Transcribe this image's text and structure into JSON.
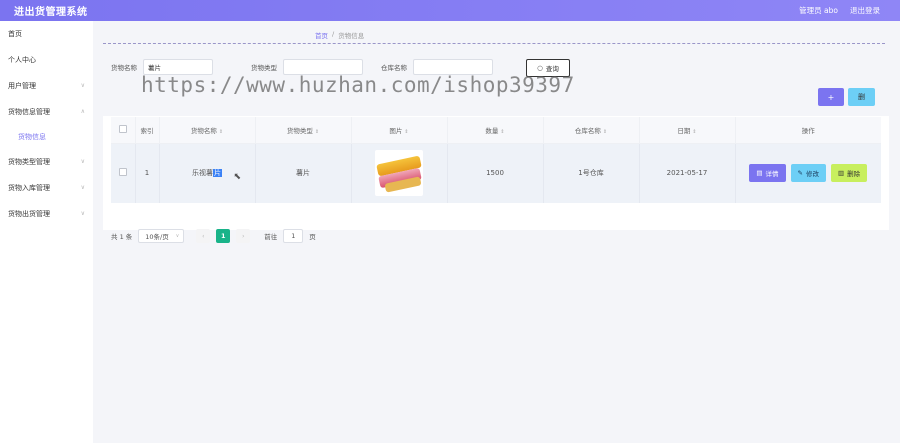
{
  "header": {
    "title": "进出货管理系统",
    "user_label": "管理员 abo",
    "logout_label": "退出登录"
  },
  "sidebar": {
    "items": [
      {
        "label": "首页"
      },
      {
        "label": "个人中心"
      },
      {
        "label": "用户管理"
      },
      {
        "label": "货物信息管理"
      },
      {
        "label": "货物信息"
      },
      {
        "label": "货物类型管理"
      },
      {
        "label": "货物入库管理"
      },
      {
        "label": "货物出货管理"
      }
    ]
  },
  "breadcrumb": {
    "home": "首页",
    "separator": "/",
    "current": "货物信息"
  },
  "search": {
    "field1_label": "货物名称",
    "field1_value": "薯片",
    "field2_label": "货物类型",
    "field3_label": "仓库名称",
    "query_label": "查询"
  },
  "watermark": "https://www.huzhan.com/ishop39397",
  "actions": {
    "add_label": "+",
    "delete_label": "删"
  },
  "table": {
    "headers": [
      "索引",
      "货物名称",
      "货物类型",
      "图片",
      "数量",
      "仓库名称",
      "日期",
      "操作"
    ],
    "rows": [
      {
        "index": "1",
        "name_pre": "乐视薯",
        "name_hl": "片",
        "type": "薯片",
        "quantity": "1500",
        "warehouse": "1号仓库",
        "date": "2021-05-17",
        "detail_label": "详情",
        "edit_label": "修改",
        "delete_label": "删除"
      }
    ]
  },
  "pagination": {
    "total": "共 1 条",
    "page_size": "10条/页",
    "current_page": "1",
    "goto_label": "前往",
    "goto_value": "1",
    "page_suffix": "页"
  },
  "colors": {
    "accent": "#7b74f0",
    "edit": "#6dcff6",
    "delete": "#c8ef5e",
    "active_page": "#19b389"
  }
}
